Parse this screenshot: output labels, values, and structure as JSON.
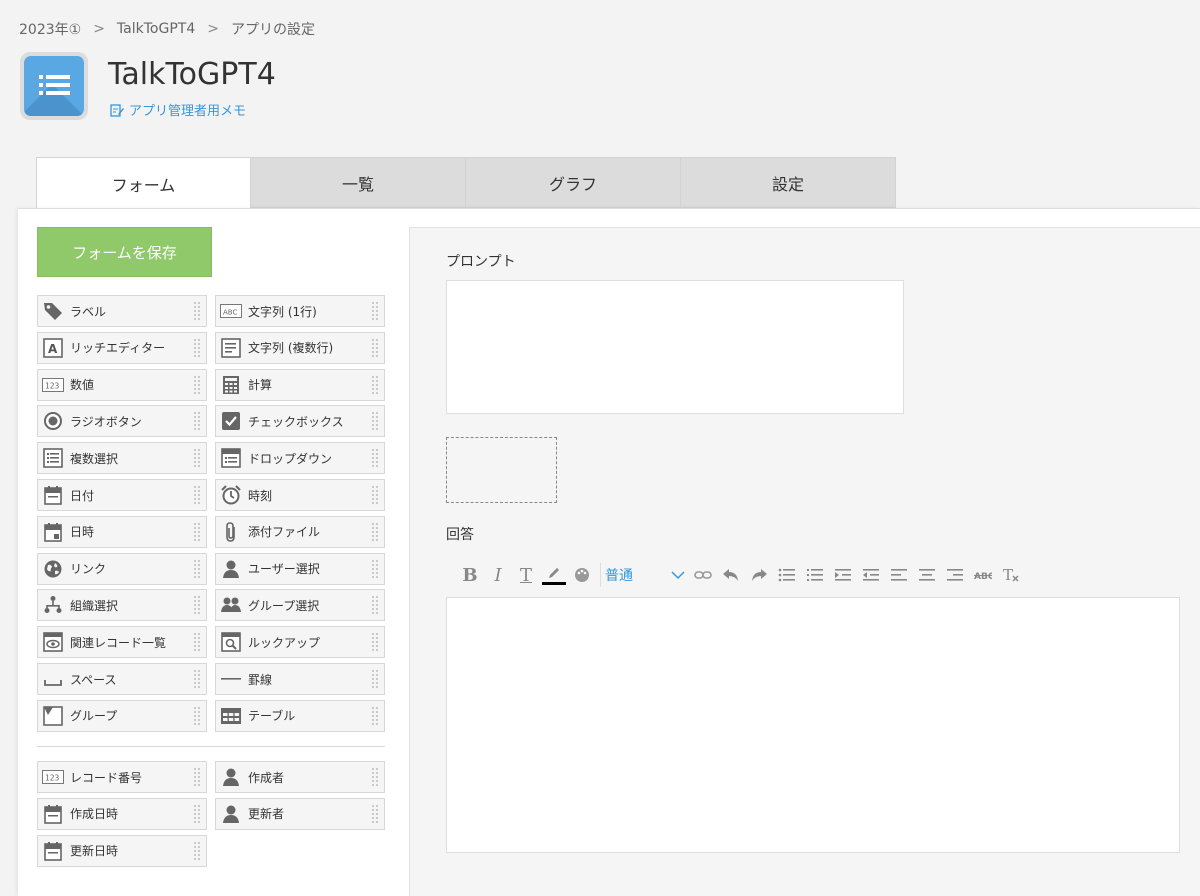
{
  "breadcrumb": {
    "item1": "2023年①",
    "item2": "TalkToGPT4",
    "item3": "アプリの設定",
    "sep": ">"
  },
  "app": {
    "title": "TalkToGPT4",
    "memo_label": "アプリ管理者用メモ"
  },
  "tabs": [
    "フォーム",
    "一覧",
    "グラフ",
    "設定"
  ],
  "save_button": "フォームを保存",
  "palette": {
    "fields": [
      {
        "label": "ラベル",
        "icon": "tag-icon"
      },
      {
        "label": "文字列 (1行)",
        "icon": "abc-icon"
      },
      {
        "label": "リッチエディター",
        "icon": "rich-editor-icon"
      },
      {
        "label": "文字列 (複数行)",
        "icon": "multiline-text-icon"
      },
      {
        "label": "数値",
        "icon": "number-icon"
      },
      {
        "label": "計算",
        "icon": "calculator-icon"
      },
      {
        "label": "ラジオボタン",
        "icon": "radio-icon"
      },
      {
        "label": "チェックボックス",
        "icon": "checkbox-icon"
      },
      {
        "label": "複数選択",
        "icon": "multi-select-icon"
      },
      {
        "label": "ドロップダウン",
        "icon": "dropdown-icon"
      },
      {
        "label": "日付",
        "icon": "calendar-icon"
      },
      {
        "label": "時刻",
        "icon": "alarm-clock-icon"
      },
      {
        "label": "日時",
        "icon": "calendar-time-icon"
      },
      {
        "label": "添付ファイル",
        "icon": "paperclip-icon"
      },
      {
        "label": "リンク",
        "icon": "globe-icon"
      },
      {
        "label": "ユーザー選択",
        "icon": "user-icon"
      },
      {
        "label": "組織選択",
        "icon": "org-chart-icon"
      },
      {
        "label": "グループ選択",
        "icon": "group-icon"
      },
      {
        "label": "関連レコード一覧",
        "icon": "related-records-icon"
      },
      {
        "label": "ルックアップ",
        "icon": "lookup-icon"
      },
      {
        "label": "スペース",
        "icon": "space-icon"
      },
      {
        "label": "罫線",
        "icon": "line-icon"
      },
      {
        "label": "グループ",
        "icon": "group-folder-icon"
      },
      {
        "label": "テーブル",
        "icon": "table-icon"
      }
    ],
    "system": [
      {
        "label": "レコード番号",
        "icon": "number-icon"
      },
      {
        "label": "作成者",
        "icon": "user-icon"
      },
      {
        "label": "作成日時",
        "icon": "calendar-icon"
      },
      {
        "label": "更新者",
        "icon": "user-icon"
      },
      {
        "label": "更新日時",
        "icon": "calendar-icon"
      }
    ]
  },
  "form": {
    "prompt_label": "プロンプト",
    "answer_label": "回答",
    "font_select": "普通"
  },
  "colors": {
    "accent": "#3498db",
    "save": "#90c96a",
    "app_icon": "#5aa8e3"
  }
}
